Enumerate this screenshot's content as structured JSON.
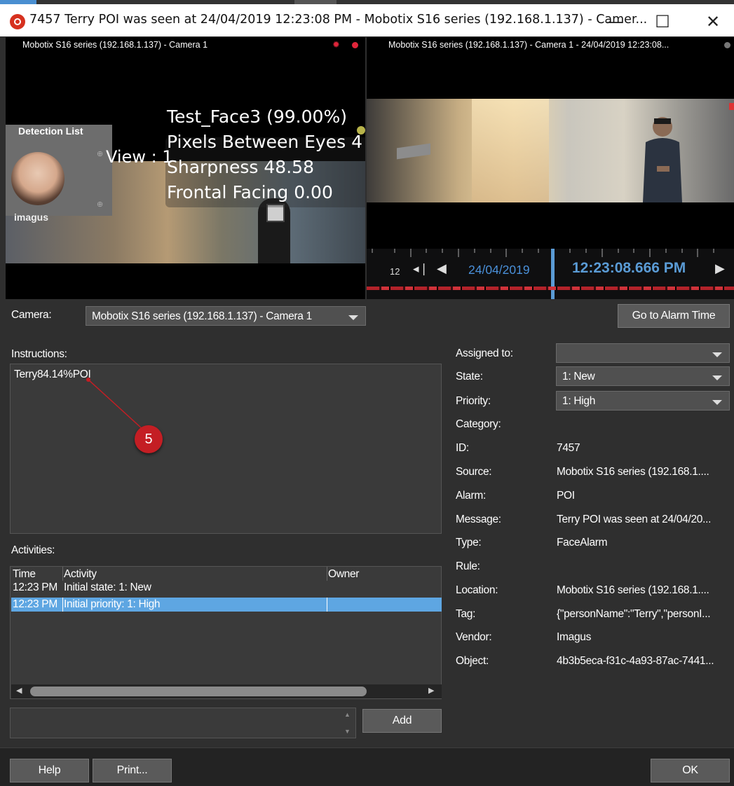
{
  "window": {
    "title": "7457 Terry POI was seen at 24/04/2019 12:23:08 PM - Mobotix S16 series (192.168.1.137) - Camer...",
    "minimize_glyph": "—",
    "maximize_glyph": "☐",
    "close_glyph": "✕",
    "icon": "camera-alarm-icon"
  },
  "left_video": {
    "camera_label": "Mobotix S16 series (192.168.1.137) - Camera 1",
    "detection_list_title": "Detection List",
    "imagus_label": "imagus",
    "view_label": "View : 1",
    "overlay": {
      "name": "Test_Face3 (99.00%)",
      "pixels": "Pixels Between Eyes 4",
      "sharpness": "Sharpness 48.58",
      "frontal": "Frontal Facing 0.00"
    },
    "recording_indicator_color": "#e0253a"
  },
  "right_video": {
    "camera_label": "Mobotix S16 series (192.168.1.137) - Camera 1 - 24/04/2019 12:23:08...",
    "timeline": {
      "hour_label": "12",
      "date": "24/04/2019",
      "time": "12:23:08.666 PM"
    }
  },
  "camera": {
    "label": "Camera:",
    "selected": "Mobotix S16 series (192.168.1.137) - Camera 1"
  },
  "go_to_alarm_label": "Go to Alarm Time",
  "instructions": {
    "label": "Instructions:",
    "text": "Terry84.14%POI"
  },
  "callout": {
    "number": "5",
    "color": "#c41e24"
  },
  "activities": {
    "label": "Activities:",
    "columns": [
      "Time",
      "Activity",
      "Owner"
    ],
    "rows": [
      {
        "time": "12:23 PM",
        "activity": "Initial state: 1: New",
        "owner": ""
      },
      {
        "time": "12:23 PM",
        "activity": "Initial priority: 1: High",
        "owner": "",
        "selected": true
      }
    ]
  },
  "add_label": "Add",
  "details": {
    "assigned_to": {
      "label": "Assigned to:",
      "value": ""
    },
    "state": {
      "label": "State:",
      "value": "1: New"
    },
    "priority": {
      "label": "Priority:",
      "value": "1: High"
    },
    "category": {
      "label": "Category:",
      "value": ""
    },
    "id": {
      "label": "ID:",
      "value": "7457"
    },
    "source": {
      "label": "Source:",
      "value": "Mobotix S16 series (192.168.1...."
    },
    "alarm": {
      "label": "Alarm:",
      "value": "POI"
    },
    "message": {
      "label": "Message:",
      "value": "Terry POI was seen at 24/04/20..."
    },
    "type": {
      "label": "Type:",
      "value": "FaceAlarm"
    },
    "rule": {
      "label": "Rule:",
      "value": ""
    },
    "location": {
      "label": "Location:",
      "value": "Mobotix S16 series (192.168.1...."
    },
    "tag": {
      "label": "Tag:",
      "value": "{\"personName\":\"Terry\",\"personI..."
    },
    "vendor": {
      "label": "Vendor:",
      "value": "Imagus"
    },
    "object": {
      "label": "Object:",
      "value": "4b3b5eca-f31c-4a93-87ac-7441..."
    }
  },
  "footer": {
    "help_label": "Help",
    "print_label": "Print...",
    "ok_label": "OK"
  },
  "colors": {
    "selection": "#5ea6e2",
    "timeline_accent": "#5a9bd5",
    "timeline_date": "#4a90d9"
  }
}
